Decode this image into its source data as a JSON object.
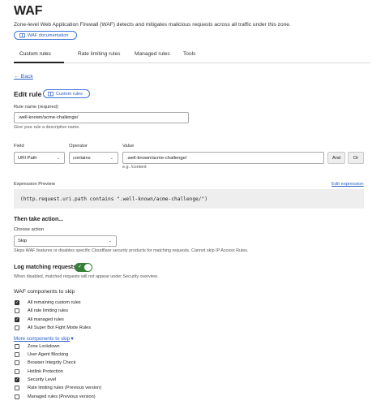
{
  "page": {
    "title": "WAF",
    "subtitle": "Zone-level Web Application Firewall (WAF) detects and mitigates malicious requests across all traffic under this zone.",
    "doc_link": "WAF documentation"
  },
  "tabs": [
    "Custom rules",
    "Rate limiting rules",
    "Managed rules",
    "Tools"
  ],
  "back": "← Back",
  "edit": {
    "heading": "Edit rule",
    "pill": "Custom rules"
  },
  "rule_name": {
    "label": "Rule name (required)",
    "value": ".well-known/acme-challenge/",
    "help": "Give your rule a descriptive name."
  },
  "expression": {
    "field_label": "Field",
    "field_value": "URI Path",
    "operator_label": "Operator",
    "operator_value": "contains",
    "value_label": "Value",
    "value_value": ".well-known/acme-challenge/",
    "value_help": "e.g. /content",
    "and_btn": "And",
    "or_btn": "Or"
  },
  "preview": {
    "label": "Expression Preview",
    "edit_link": "Edit expression",
    "code": "(http.request.uri.path contains \".well-known/acme-challenge/\")"
  },
  "action": {
    "heading": "Then take action...",
    "choose_label": "Choose action",
    "selected": "Skip",
    "help": "Skips WAF features or disables specific Cloudflare security products for matching requests. Cannot skip IP Access Rules."
  },
  "logging": {
    "label": "Log matching requests",
    "enabled": true,
    "help": "When disabled, matched requests will not appear under Security overview."
  },
  "skip": {
    "heading": "WAF components to skip",
    "items": [
      {
        "label": "All remaining custom rules",
        "checked": true
      },
      {
        "label": "All rate limiting rules",
        "checked": false
      },
      {
        "label": "All managed rules",
        "checked": true
      },
      {
        "label": "All Super Bot Fight Mode Rules",
        "checked": false
      }
    ],
    "more_label": "More components to skip",
    "more_items": [
      {
        "label": "Zone Lockdown",
        "checked": false
      },
      {
        "label": "User Agent Blocking",
        "checked": false
      },
      {
        "label": "Browser Integrity Check",
        "checked": false
      },
      {
        "label": "Hotlink Protection",
        "checked": false
      },
      {
        "label": "Security Level",
        "checked": true
      },
      {
        "label": "Rate limiting rules (Previous version)",
        "checked": false
      },
      {
        "label": "Managed rules (Previous version)",
        "checked": false
      }
    ]
  }
}
